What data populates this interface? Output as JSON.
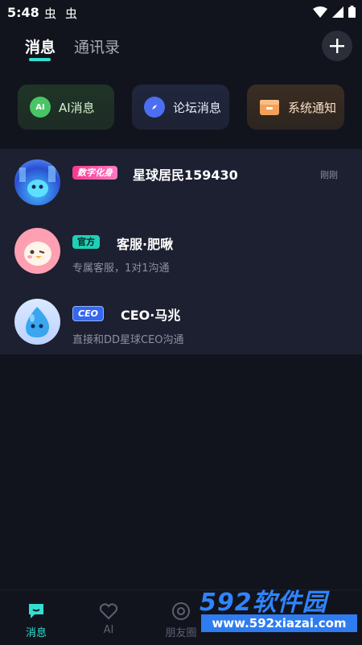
{
  "status_bar": {
    "time": "5:48",
    "bug_icons": [
      "虫",
      "虫"
    ]
  },
  "header": {
    "tabs": [
      {
        "label": "消息",
        "active": true
      },
      {
        "label": "通讯录",
        "active": false
      }
    ],
    "add_icon": "plus-icon"
  },
  "quick_actions": [
    {
      "label": "AI消息",
      "icon_text": "AI",
      "color": "#48c564"
    },
    {
      "label": "论坛消息",
      "icon": "compass-icon",
      "color": "#4c6ff2"
    },
    {
      "label": "系统通知",
      "icon": "box-icon",
      "color": "#f2a159"
    }
  ],
  "chats": [
    {
      "badge": "数字化身",
      "badge_color": "#f03a8f",
      "name": "星球居民159430",
      "subtitle": "",
      "time": "刚刚"
    },
    {
      "badge": "官方",
      "badge_color": "#1fcfb7",
      "name": "客服·肥啾",
      "subtitle": "专属客服，1对1沟通",
      "time": ""
    },
    {
      "badge": "CEO",
      "badge_color": "#3567f0",
      "name": "CEO·马兆",
      "subtitle": "直接和DD星球CEO沟通",
      "time": ""
    }
  ],
  "bottom_nav": [
    {
      "label": "消息",
      "active": true,
      "color": "#33dfd0"
    },
    {
      "label": "AI",
      "active": false
    },
    {
      "label": "朋友圈",
      "active": false
    }
  ],
  "watermark": {
    "brand": "592软件园",
    "url": "www.592xiazai.com"
  }
}
